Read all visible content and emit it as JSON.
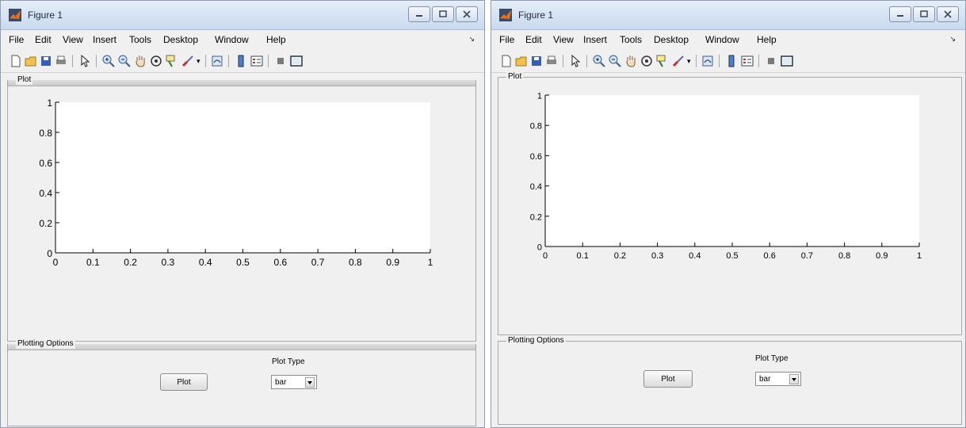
{
  "window_title": "Figure 1",
  "menus": [
    "File",
    "Edit",
    "View",
    "Insert",
    "Tools",
    "Desktop",
    "Window",
    "Help"
  ],
  "plot_panel_title": "Plot",
  "options_panel_title": "Plotting Options",
  "plot_button_label": "Plot",
  "plot_type_label": "Plot Type",
  "plot_type_value": "bar",
  "toolbar_icons": [
    "new-figure-icon",
    "open-file-icon",
    "save-icon",
    "print-icon",
    "pointer-icon",
    "zoom-in-icon",
    "zoom-out-icon",
    "pan-hand-icon",
    "rotate-3d-icon",
    "data-cursor-icon",
    "brush-icon",
    "link-plot-icon",
    "colorbar-icon",
    "legend-icon",
    "hide-plot-tools-icon",
    "show-plot-tools-icon"
  ],
  "axes": {
    "x_ticks": [
      "0",
      "0.1",
      "0.2",
      "0.3",
      "0.4",
      "0.5",
      "0.6",
      "0.7",
      "0.8",
      "0.9",
      "1"
    ],
    "y_ticks": [
      "0",
      "0.2",
      "0.4",
      "0.6",
      "0.8",
      "1"
    ],
    "xlim": [
      0,
      1
    ],
    "ylim": [
      0,
      1
    ]
  },
  "colors": {
    "titlebar": "#d6e3f3",
    "panel_bg": "#f0f0f0",
    "axes_bg": "#ffffff",
    "matlab_orange": "#e8751a"
  }
}
